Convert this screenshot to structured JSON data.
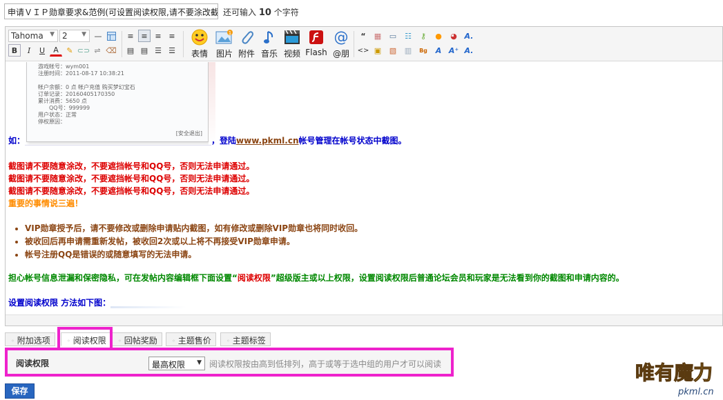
{
  "title_input": {
    "value": "申请ＶＩＰ勋章要求&范例(可设置阅读权限,请不要涂改截"
  },
  "char_count": {
    "prefix": "还可输入",
    "number": "10",
    "suffix": "个字符"
  },
  "toolbar": {
    "font_family": "Tahoma",
    "font_size": "2",
    "big_buttons": [
      {
        "label": "表情",
        "icon": "smiley-icon"
      },
      {
        "label": "图片",
        "icon": "image-icon"
      },
      {
        "label": "附件",
        "icon": "paperclip-icon"
      },
      {
        "label": "音乐",
        "icon": "music-icon"
      },
      {
        "label": "视频",
        "icon": "video-icon"
      },
      {
        "label": "Flash",
        "icon": "flash-icon"
      },
      {
        "label": "@朋",
        "icon": "at-icon"
      }
    ]
  },
  "content": {
    "shot": {
      "lines": [
        "游戏帐号：wym001",
        "注册时间：2011-08-17 10:38:21",
        "",
        "帐户余额：0 点  帐户充值    购买梦幻宝石",
        "订单记录：20160405170350",
        "累计消费：5650 点",
        "　　QQ号：999999",
        "用户状态：正常",
        "停权原因："
      ],
      "exit": "[安全退出]"
    },
    "example_prefix": "如：",
    "example_mid": "，登陆",
    "example_link": "www.pkml.cn",
    "example_suffix": "帐号管理在帐号状态中截图。",
    "warn": "截图请不要随意涂改，不要遮挡帐号和QQ号，否则无法申请通过。",
    "important": "重要的事情说三遍！",
    "bullets": [
      "VIP勋章授予后，请不要修改或删除申请贴内截图，如有修改或删除VIP勋章也将同时收回。",
      "被收回后再申请需重新发帖，被收回2次或以上将不再接受VIP勋章申请。",
      "帐号注册QQ是错误的或随意填写的无法申请。"
    ],
    "privacy_a": "担心帐号信息泄漏和保密隐私，可在发帖内容编辑框下面设置“",
    "privacy_red": "阅读权限",
    "privacy_b": "”超级版主或以上权限，设置阅读权限后普通论坛会员和玩家是无法看到你的截图和申请内容的。",
    "method": "设置阅读权限 方法如下图："
  },
  "tabs": [
    "附加选项",
    "阅读权限",
    "回帖奖励",
    "主题售价",
    "主题标签"
  ],
  "permission": {
    "label": "阅读权限",
    "selected": "最高权限",
    "hint": "阅读权限按由高到低排列，高于或等于选中组的用户才可以阅读"
  },
  "save_label": "保存",
  "watermark": {
    "text": "唯有魔力",
    "url": "pkml.cn"
  },
  "colors": {
    "highlight": "#ee22cc",
    "save_bg": "#2866bf"
  }
}
